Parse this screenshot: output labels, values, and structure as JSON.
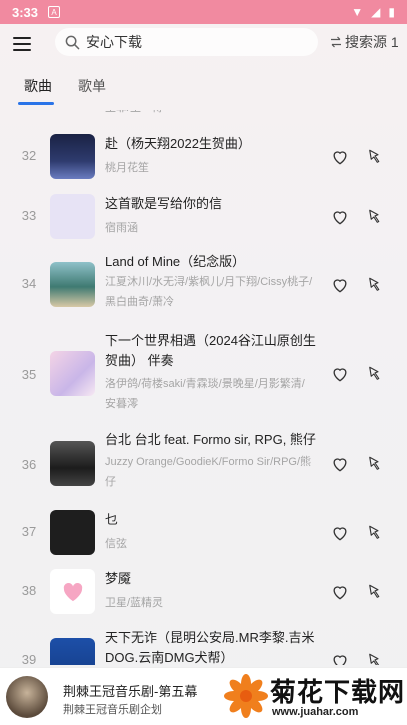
{
  "status_bar": {
    "time": "3:33"
  },
  "toolbar": {
    "search_value": "安心下载",
    "source_label": "搜索源 1"
  },
  "tabs": [
    {
      "label": "歌曲",
      "active": true
    },
    {
      "label": "歌单",
      "active": false
    }
  ],
  "top_partial": {
    "artist": "王菲/王一博"
  },
  "songs": [
    {
      "num": "32",
      "title": "赴（杨天翔2022生贺曲）",
      "artist": "桃月花笙"
    },
    {
      "num": "33",
      "title": "这首歌是写给你的信",
      "artist": "宿雨涵"
    },
    {
      "num": "34",
      "title": "Land of Mine（纪念版）",
      "artist": "江夏沐川/水无浔/紫枫儿/月下翔/Cissy桃子/黑白曲奇/萧冷"
    },
    {
      "num": "35",
      "title": "下一个世界相遇（2024谷江山原创生贺曲） 伴奏",
      "artist": "洛伊鸽/荷楼saki/青霖琰/景晚星/月影繁清/安暮澪"
    },
    {
      "num": "36",
      "title": "台北 台北 feat. Formo sir, RPG, 熊仔",
      "artist": "Juzzy Orange/GoodieK/Formo Sir/RPG/熊仔"
    },
    {
      "num": "37",
      "title": "乜",
      "artist": "信弦"
    },
    {
      "num": "38",
      "title": "梦魇",
      "artist": "卫星/蓝精灵"
    },
    {
      "num": "39",
      "title": "天下无诈（昆明公安局.MR李黎.吉米DOG.云南DMG犬帮）",
      "artist": ""
    }
  ],
  "player": {
    "title": "荆棘王冠音乐剧-第五幕",
    "subtitle": "荆棘王冠音乐剧企划"
  },
  "watermark": {
    "brand": "菊花下载网",
    "url": "www.juahar.com"
  },
  "colors": {
    "status_bar": "#f18aa0",
    "tab_indicator": "#2a74e8"
  }
}
